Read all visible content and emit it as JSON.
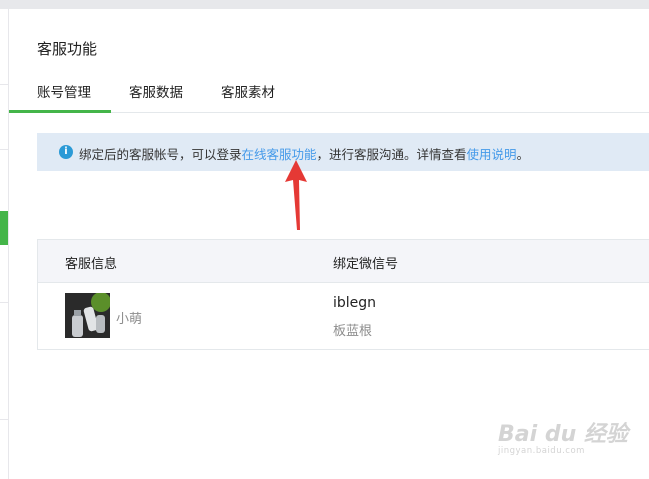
{
  "page": {
    "title": "客服功能"
  },
  "tabs": [
    {
      "label": "账号管理",
      "active": true
    },
    {
      "label": "客服数据",
      "active": false
    },
    {
      "label": "客服素材",
      "active": false
    }
  ],
  "notice": {
    "icon": "info-icon",
    "prefix": "绑定后的客服帐号，可以登录",
    "link1": "在线客服功能",
    "middle": "，进行客服沟通。详情查看",
    "link2": "使用说明",
    "suffix": "。"
  },
  "table": {
    "headers": [
      "客服信息",
      "绑定微信号"
    ],
    "rows": [
      {
        "nickname": "小萌",
        "wechat_id": "iblegn",
        "wechat_nickname": "板蓝根"
      }
    ]
  },
  "watermark": {
    "brand": "Bai du 经验",
    "url": "jingyan.baidu.com"
  },
  "colors": {
    "accent": "#44b549",
    "link": "#459ae9",
    "notice_bg": "#e0eaf5",
    "arrow": "#e53935"
  }
}
